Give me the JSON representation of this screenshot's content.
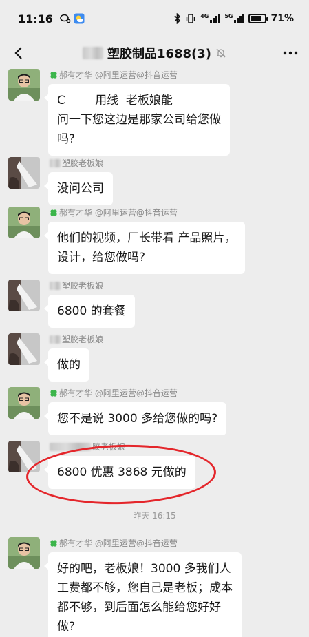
{
  "status_bar": {
    "time": "11:16",
    "net_4g": "4G",
    "net_5g": "5G",
    "battery": "71%",
    "battery_level": 0.71
  },
  "nav": {
    "title": "塑胶制品1688(3)"
  },
  "senders": {
    "a": "郝有才华 @阿里运营@抖音运营",
    "b": "塑胶老板娘"
  },
  "messages": [
    {
      "side": "a",
      "sender": "郝有才华 @阿里运营@抖音运营",
      "lines": [
        "C        用线  老板娘能",
        "问一下您这边是那家公司给您做",
        "吗?"
      ]
    },
    {
      "side": "b",
      "sender": "塑胶老板娘",
      "lines": [
        "没问公司"
      ]
    },
    {
      "side": "a",
      "sender": "郝有才华 @阿里运营@抖音运营",
      "lines": [
        "他们的视频，厂长带看 产品照片，",
        "设计，给您做吗?"
      ]
    },
    {
      "side": "b",
      "sender": "塑胶老板娘",
      "lines": [
        "6800 的套餐"
      ]
    },
    {
      "side": "b",
      "sender": "塑胶老板娘",
      "lines": [
        "做的"
      ]
    },
    {
      "side": "a",
      "sender": "郝有才华 @阿里运营@抖音运营",
      "lines": [
        "您不是说 3000 多给您做的吗?"
      ]
    },
    {
      "side": "b",
      "sender": "胶老板娘",
      "lines": [
        "6800 优惠 3868 元做的"
      ]
    },
    {
      "side": "a",
      "sender": "郝有才华 @阿里运营@抖音运营",
      "lines": [
        "好的吧，老板娘！3000 多我们人",
        "工费都不够，您自己是老板；成本",
        "都不够，到后面怎么能给您好好",
        "做?"
      ]
    }
  ],
  "timestamp": "昨天 16:15",
  "colors": {
    "background": "#ededed",
    "bubble": "#ffffff",
    "annotation_circle": "#e4262b",
    "clover": "#3bb54a"
  }
}
